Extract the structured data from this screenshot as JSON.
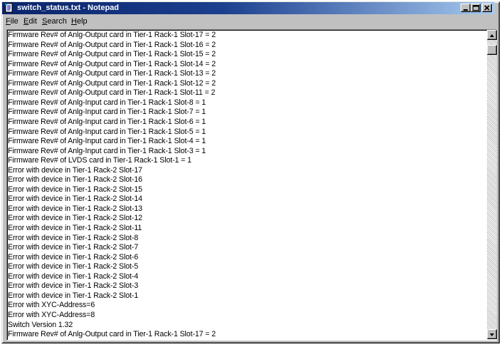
{
  "window": {
    "title": "switch_status.txt - Notepad",
    "controls": {
      "minimize": "_",
      "maximize": "□",
      "close": "×"
    }
  },
  "menu": [
    {
      "label_underlined": "F",
      "label_rest": "ile"
    },
    {
      "label_underlined": "E",
      "label_rest": "dit"
    },
    {
      "label_underlined": "S",
      "label_rest": "earch"
    },
    {
      "label_underlined": "H",
      "label_rest": "elp"
    }
  ],
  "editor": {
    "lines": [
      "Firmware Rev# of Anlg-Output card in Tier-1 Rack-1 Slot-17 = 2",
      "Firmware Rev# of Anlg-Output card in Tier-1 Rack-1 Slot-16 = 2",
      "Firmware Rev# of Anlg-Output card in Tier-1 Rack-1 Slot-15 = 2",
      "Firmware Rev# of Anlg-Output card in Tier-1 Rack-1 Slot-14 = 2",
      "Firmware Rev# of Anlg-Output card in Tier-1 Rack-1 Slot-13 = 2",
      "Firmware Rev# of Anlg-Output card in Tier-1 Rack-1 Slot-12 = 2",
      "Firmware Rev# of Anlg-Output card in Tier-1 Rack-1 Slot-11 = 2",
      "Firmware Rev# of Anlg-Input card in Tier-1 Rack-1 Slot-8 = 1",
      "Firmware Rev# of Anlg-Input card in Tier-1 Rack-1 Slot-7 = 1",
      "Firmware Rev# of Anlg-Input card in Tier-1 Rack-1 Slot-6 = 1",
      "Firmware Rev# of Anlg-Input card in Tier-1 Rack-1 Slot-5 = 1",
      "Firmware Rev# of Anlg-Input card in Tier-1 Rack-1 Slot-4 = 1",
      "Firmware Rev# of Anlg-Input card in Tier-1 Rack-1 Slot-3 = 1",
      "Firmware Rev# of LVDS card in Tier-1 Rack-1 Slot-1 = 1",
      "Error with device in Tier-1 Rack-2 Slot-17",
      "Error with device in Tier-1 Rack-2 Slot-16",
      "Error with device in Tier-1 Rack-2 Slot-15",
      "Error with device in Tier-1 Rack-2 Slot-14",
      "Error with device in Tier-1 Rack-2 Slot-13",
      "Error with device in Tier-1 Rack-2 Slot-12",
      "Error with device in Tier-1 Rack-2 Slot-11",
      "Error with device in Tier-1 Rack-2 Slot-8",
      "Error with device in Tier-1 Rack-2 Slot-7",
      "Error with device in Tier-1 Rack-2 Slot-6",
      "Error with device in Tier-1 Rack-2 Slot-5",
      "Error with device in Tier-1 Rack-2 Slot-4",
      "Error with device in Tier-1 Rack-2 Slot-3",
      "Error with device in Tier-1 Rack-2 Slot-1",
      "Error with XYC-Address=6",
      "Error with XYC-Address=8",
      "Switch Version 1.32",
      "Firmware Rev# of Anlg-Output card in Tier-1 Rack-1 Slot-17 = 2"
    ]
  },
  "icons": {
    "app": "notepad-icon",
    "scroll_up": "scroll-up-arrow-icon",
    "scroll_down": "scroll-down-arrow-icon"
  },
  "colors": {
    "titlebar_start": "#0a246a",
    "titlebar_end": "#a6caf0",
    "chrome": "#c0c0c0",
    "text": "#000000"
  }
}
